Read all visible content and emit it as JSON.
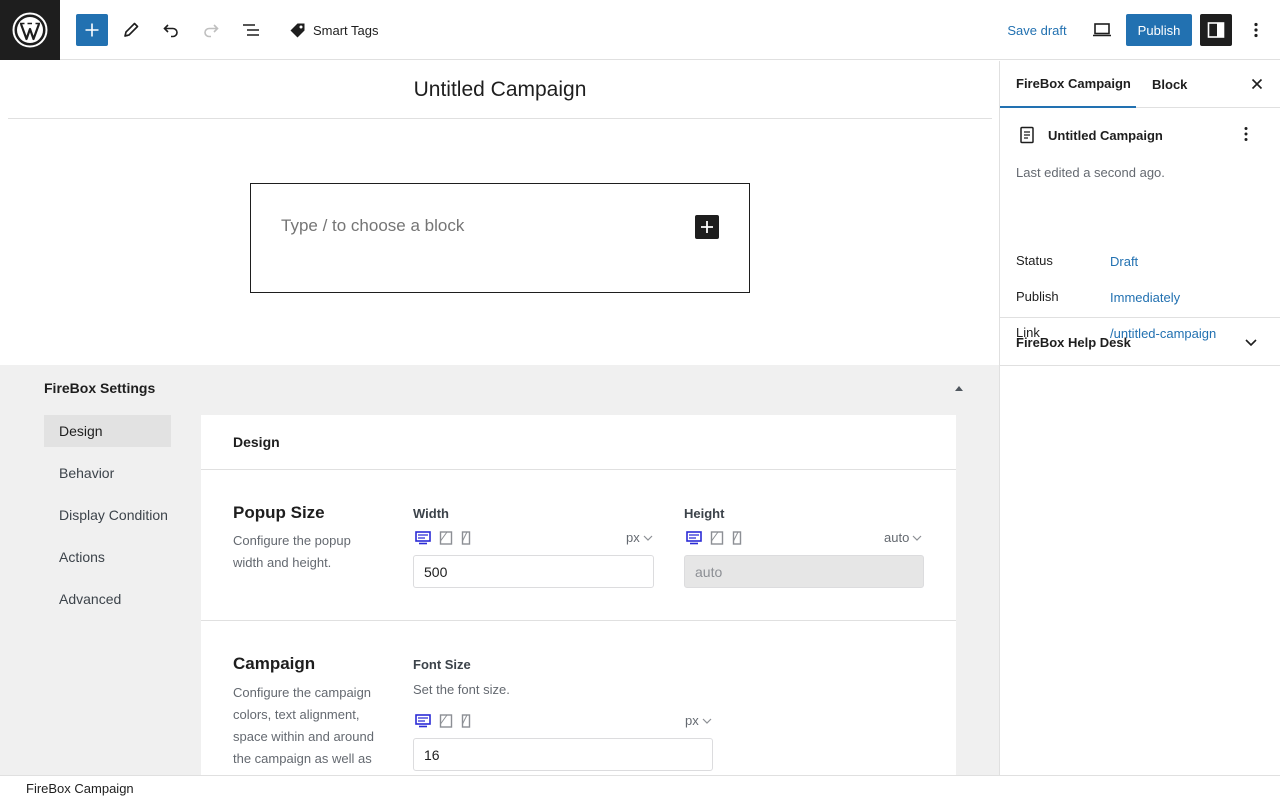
{
  "toolbar": {
    "smart_tags_label": "Smart Tags",
    "save_draft_label": "Save draft",
    "publish_label": "Publish"
  },
  "editor": {
    "post_title": "Untitled Campaign",
    "block_placeholder": "Type / to choose a block"
  },
  "firebox": {
    "heading": "FireBox Settings",
    "nav": [
      {
        "label": "Design"
      },
      {
        "label": "Behavior"
      },
      {
        "label": "Display Condition"
      },
      {
        "label": "Actions"
      },
      {
        "label": "Advanced"
      }
    ],
    "panel_title": "Design",
    "popup_size": {
      "title": "Popup Size",
      "description": "Configure the popup width and height.",
      "width_label": "Width",
      "width_unit": "px",
      "width_value": "500",
      "height_label": "Height",
      "height_unit": "auto",
      "height_value": "auto"
    },
    "campaign": {
      "title": "Campaign",
      "description": "Configure the campaign colors, text alignment, space within and around the campaign as well as it's",
      "font_size_label": "Font Size",
      "font_size_help": "Set the font size.",
      "font_size_unit": "px",
      "font_size_value": "16"
    }
  },
  "sidebar": {
    "tab_campaign": "FireBox Campaign",
    "tab_block": "Block",
    "doc_title": "Untitled Campaign",
    "last_edited": "Last edited a second ago.",
    "rows": [
      {
        "label": "Status",
        "value": "Draft"
      },
      {
        "label": "Publish",
        "value": "Immediately"
      },
      {
        "label": "Link",
        "value": "/untitled-campaign"
      }
    ],
    "help_desk_label": "FireBox Help Desk"
  },
  "footer": {
    "breadcrumb": "FireBox Campaign"
  },
  "colors": {
    "accent": "#2271b1",
    "dark": "#1e1e1e",
    "device_active": "#2b2bd6"
  }
}
